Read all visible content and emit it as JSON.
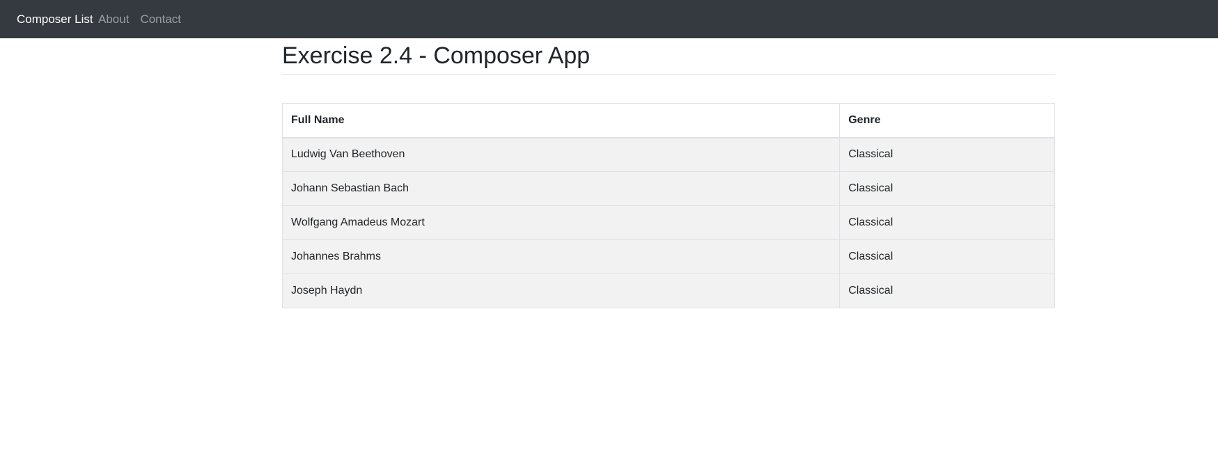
{
  "navbar": {
    "brand": "Composer List",
    "links": [
      "About",
      "Contact"
    ],
    "background": "#343a40"
  },
  "page": {
    "title": "Exercise 2.4 - Composer App"
  },
  "table": {
    "headers": [
      "Full Name",
      "Genre"
    ],
    "rows": [
      {
        "name": "Ludwig Van Beethoven",
        "genre": "Classical"
      },
      {
        "name": "Johann Sebastian Bach",
        "genre": "Classical"
      },
      {
        "name": "Wolfgang Amadeus Mozart",
        "genre": "Classical"
      },
      {
        "name": "Johannes Brahms",
        "genre": "Classical"
      },
      {
        "name": "Joseph Haydn",
        "genre": "Classical"
      }
    ],
    "striped_row_color": "#f2f2f2"
  }
}
